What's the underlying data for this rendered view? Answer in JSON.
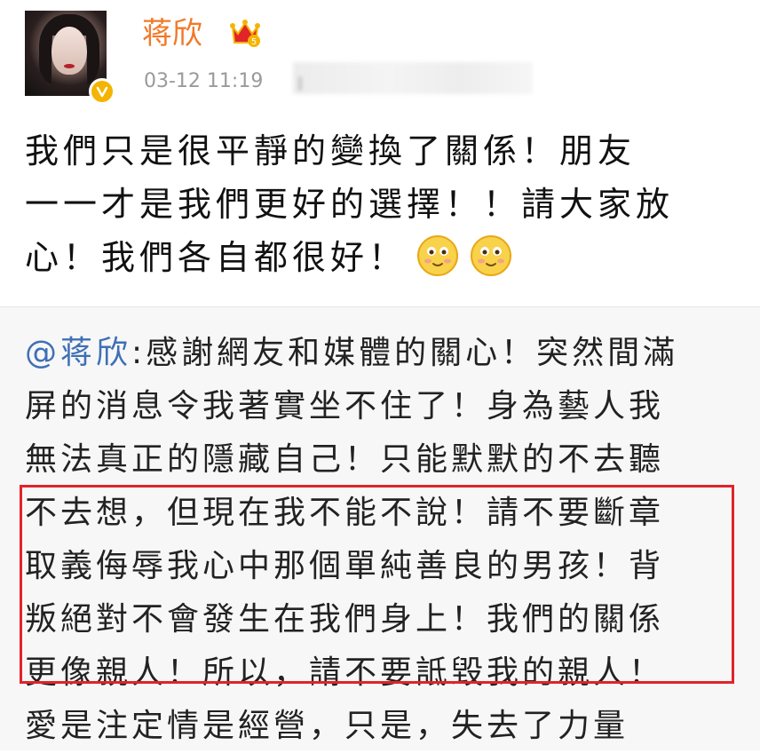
{
  "post": {
    "author": "蒋欣",
    "timestamp": "03-12 11:19",
    "lines": [
      "我們只是很平靜的變換了關係！朋友",
      "一一才是我們更好的選擇！！請大家放",
      "心！我們各自都很好！"
    ],
    "icons": [
      "vip-crown-icon",
      "verified-badge-icon",
      "smile-emoji-icon",
      "smile-emoji-icon"
    ]
  },
  "repost": {
    "mention": "@蒋欣",
    "first_line_rest": ":感謝網友和媒體的關心！突然間滿",
    "lines": [
      "屏的消息令我著實坐不住了！身為藝人我",
      "無法真正的隱藏自己！只能默默的不去聽",
      "不去想，但現在我不能不說！請不要斷章",
      "取義侮辱我心中那個單純善良的男孩！背",
      "叛絕對不會發生在我們身上！我們的關係",
      "更像親人！所以，請不要詆毀我的親人！",
      "愛是注定情是經營，只是，失去了力量"
    ]
  },
  "colors": {
    "username": "#f07a2a",
    "mention": "#3f6fb6",
    "highlight_border": "#e0242a",
    "verified": "#f4b400"
  }
}
